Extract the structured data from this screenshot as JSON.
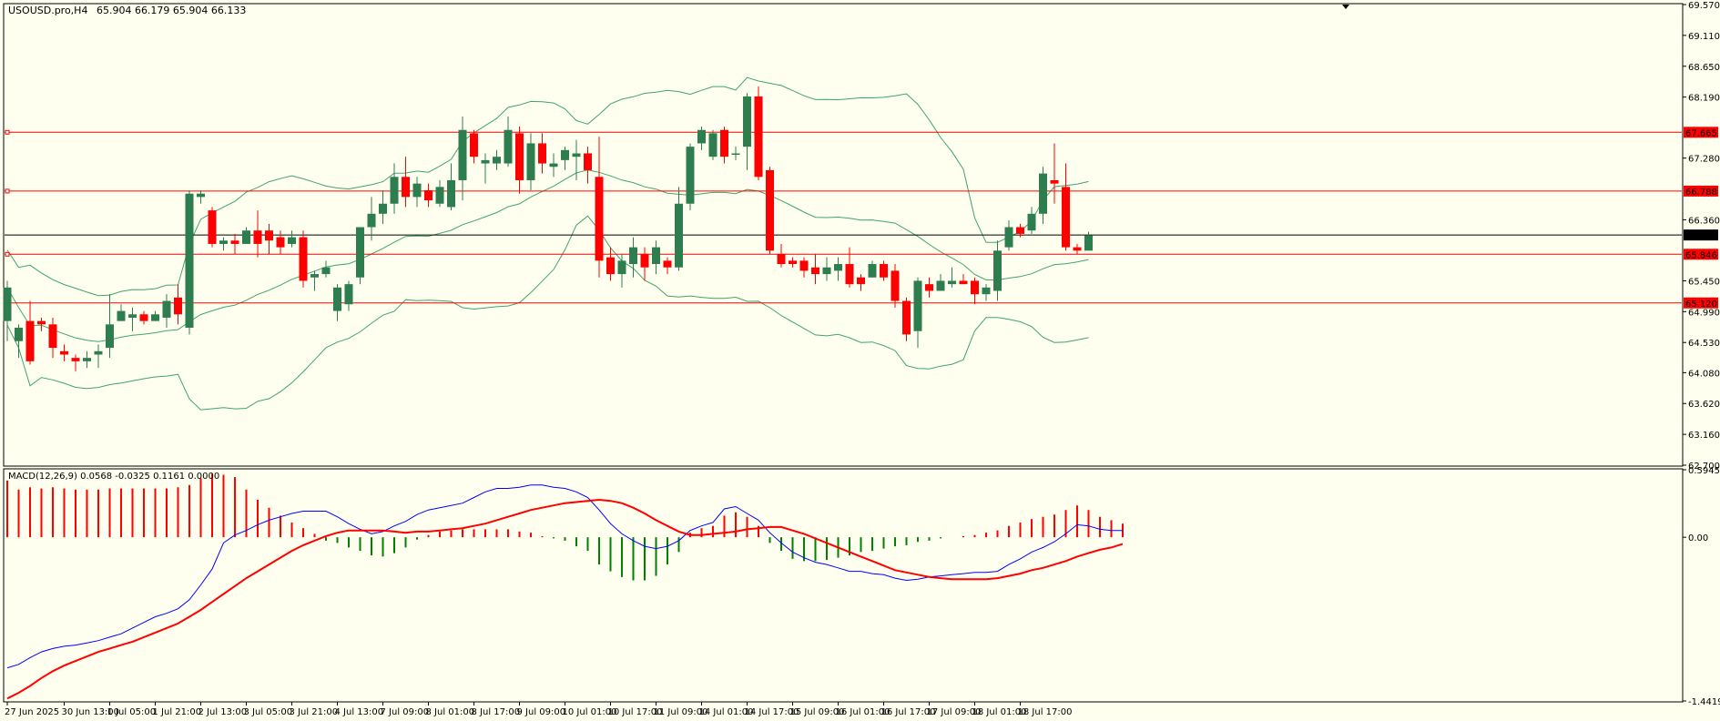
{
  "header": {
    "symbol": "USOUSD.pro,H4",
    "ohlc": "65.904 66.179 65.904 66.133"
  },
  "macd_header": {
    "label": "MACD(12,26,9) 0.0568 -0.0325 0.1161 0.0000"
  },
  "colors": {
    "background": "#FFFFF0",
    "bull_candle": "#2E7D4F",
    "bear_candle": "#FF0000",
    "bollinger": "#3FA56B",
    "hline": "#FF0000",
    "current_price": "#000000",
    "macd_line": "#0000FF",
    "signal_line": "#FF0000"
  },
  "chart_data": [
    {
      "type": "candlestick",
      "title": "USOUSD.pro,H4",
      "ylim": [
        62.7,
        69.57
      ],
      "y_ticks": [
        "69.570",
        "69.110",
        "68.650",
        "68.190",
        "67.280",
        "66.360",
        "65.450",
        "64.990",
        "64.530",
        "64.080",
        "63.620",
        "63.160",
        "62.700"
      ],
      "x_ticks": [
        "27 Jun 2025",
        "30 Jun 13:00",
        "1 Jul 05:00",
        "1 Jul 21:00",
        "2 Jul 13:00",
        "3 Jul 05:00",
        "3 Jul 21:00",
        "4 Jul 13:00",
        "7 Jul 09:00",
        "8 Jul 01:00",
        "8 Jul 17:00",
        "9 Jul 09:00",
        "10 Jul 01:00",
        "10 Jul 17:00",
        "11 Jul 09:00",
        "14 Jul 01:00",
        "14 Jul 17:00",
        "15 Jul 09:00",
        "16 Jul 01:00",
        "16 Jul 17:00",
        "17 Jul 09:00",
        "18 Jul 01:00",
        "18 Jul 17:00"
      ],
      "horizontal_lines": [
        {
          "price": 67.665,
          "label": "67.665"
        },
        {
          "price": 66.788,
          "label": "66.788"
        },
        {
          "price": 65.846,
          "label": "65.846"
        },
        {
          "price": 65.12,
          "label": "65.120"
        }
      ],
      "current_price": {
        "price": 66.133,
        "label": "66.133"
      },
      "candles": [
        [
          64.85,
          65.35,
          64.55,
          65.45
        ],
        [
          64.55,
          64.75,
          64.3,
          64.8
        ],
        [
          64.85,
          64.25,
          64.2,
          65.15
        ],
        [
          64.85,
          64.8,
          64.7,
          64.9
        ],
        [
          64.8,
          64.45,
          64.3,
          64.9
        ],
        [
          64.4,
          64.35,
          64.25,
          64.5
        ],
        [
          64.3,
          64.25,
          64.1,
          64.35
        ],
        [
          64.25,
          64.3,
          64.15,
          64.4
        ],
        [
          64.35,
          64.4,
          64.15,
          64.5
        ],
        [
          64.45,
          64.8,
          64.3,
          65.25
        ],
        [
          64.85,
          65.0,
          64.85,
          65.1
        ],
        [
          64.9,
          64.95,
          64.7,
          65.05
        ],
        [
          64.95,
          64.85,
          64.8,
          65.0
        ],
        [
          64.85,
          64.95,
          64.85,
          65.0
        ],
        [
          64.9,
          65.15,
          64.75,
          65.25
        ],
        [
          65.2,
          64.95,
          64.8,
          65.4
        ],
        [
          64.75,
          66.75,
          64.65,
          66.8
        ],
        [
          66.7,
          66.75,
          66.6,
          66.8
        ],
        [
          66.5,
          66.0,
          65.95,
          66.55
        ],
        [
          66.0,
          66.05,
          65.9,
          66.1
        ],
        [
          66.05,
          66.0,
          65.85,
          66.15
        ],
        [
          66.0,
          66.2,
          66.0,
          66.25
        ],
        [
          66.2,
          66.0,
          65.8,
          66.5
        ],
        [
          66.2,
          66.05,
          65.85,
          66.3
        ],
        [
          66.1,
          65.95,
          65.85,
          66.2
        ],
        [
          66.0,
          66.1,
          65.95,
          66.2
        ],
        [
          66.1,
          65.45,
          65.35,
          66.2
        ],
        [
          65.5,
          65.55,
          65.3,
          65.6
        ],
        [
          65.55,
          65.65,
          65.5,
          65.75
        ],
        [
          65.0,
          65.35,
          64.85,
          65.4
        ],
        [
          65.1,
          65.4,
          65.0,
          65.45
        ],
        [
          65.5,
          66.25,
          65.4,
          66.25
        ],
        [
          66.25,
          66.45,
          66.05,
          66.7
        ],
        [
          66.45,
          66.6,
          66.3,
          66.8
        ],
        [
          66.6,
          67.0,
          66.45,
          67.2
        ],
        [
          67.0,
          66.7,
          66.55,
          67.3
        ],
        [
          66.7,
          66.9,
          66.55,
          67.0
        ],
        [
          66.8,
          66.65,
          66.55,
          66.9
        ],
        [
          66.6,
          66.85,
          66.55,
          66.95
        ],
        [
          66.55,
          66.95,
          66.5,
          67.2
        ],
        [
          66.95,
          67.7,
          66.65,
          67.9
        ],
        [
          67.65,
          67.3,
          67.2,
          67.7
        ],
        [
          67.2,
          67.25,
          66.9,
          67.35
        ],
        [
          67.2,
          67.3,
          67.1,
          67.4
        ],
        [
          67.2,
          67.7,
          67.15,
          67.9
        ],
        [
          67.65,
          66.95,
          66.75,
          67.75
        ],
        [
          66.95,
          67.5,
          66.8,
          67.65
        ],
        [
          67.5,
          67.2,
          67.05,
          67.65
        ],
        [
          67.15,
          67.2,
          67.0,
          67.35
        ],
        [
          67.25,
          67.4,
          67.1,
          67.45
        ],
        [
          67.3,
          67.35,
          66.95,
          67.55
        ],
        [
          67.35,
          67.1,
          66.9,
          67.45
        ],
        [
          67.0,
          65.75,
          65.5,
          67.6
        ],
        [
          65.8,
          65.55,
          65.45,
          65.95
        ],
        [
          65.55,
          65.75,
          65.35,
          65.85
        ],
        [
          65.7,
          65.95,
          65.5,
          66.1
        ],
        [
          65.85,
          65.65,
          65.45,
          65.95
        ],
        [
          65.7,
          65.95,
          65.55,
          66.05
        ],
        [
          65.75,
          65.65,
          65.55,
          65.8
        ],
        [
          65.65,
          66.6,
          65.6,
          66.85
        ],
        [
          66.6,
          67.45,
          66.5,
          67.5
        ],
        [
          67.5,
          67.7,
          67.4,
          67.75
        ],
        [
          67.3,
          67.65,
          67.25,
          67.7
        ],
        [
          67.7,
          67.3,
          67.2,
          67.75
        ],
        [
          67.35,
          67.35,
          67.25,
          67.45
        ],
        [
          67.45,
          68.2,
          67.1,
          68.25
        ],
        [
          68.2,
          67.0,
          66.95,
          68.35
        ],
        [
          67.1,
          65.9,
          65.85,
          67.15
        ],
        [
          65.85,
          65.7,
          65.65,
          66.0
        ],
        [
          65.75,
          65.7,
          65.65,
          65.8
        ],
        [
          65.75,
          65.6,
          65.5,
          65.8
        ],
        [
          65.65,
          65.55,
          65.4,
          65.85
        ],
        [
          65.55,
          65.65,
          65.45,
          65.8
        ],
        [
          65.6,
          65.7,
          65.45,
          65.8
        ],
        [
          65.7,
          65.4,
          65.35,
          65.95
        ],
        [
          65.5,
          65.4,
          65.3,
          65.55
        ],
        [
          65.5,
          65.7,
          65.5,
          65.75
        ],
        [
          65.7,
          65.5,
          65.45,
          65.75
        ],
        [
          65.6,
          65.15,
          65.05,
          65.7
        ],
        [
          65.15,
          64.65,
          64.55,
          65.2
        ],
        [
          64.7,
          65.45,
          64.45,
          65.5
        ],
        [
          65.4,
          65.3,
          65.2,
          65.5
        ],
        [
          65.3,
          65.45,
          65.3,
          65.55
        ],
        [
          65.4,
          65.45,
          65.35,
          65.65
        ],
        [
          65.45,
          65.4,
          65.4,
          65.55
        ],
        [
          65.45,
          65.25,
          65.1,
          65.5
        ],
        [
          65.25,
          65.35,
          65.15,
          65.4
        ],
        [
          65.3,
          65.9,
          65.15,
          66.05
        ],
        [
          65.95,
          66.25,
          65.9,
          66.35
        ],
        [
          66.25,
          66.15,
          66.1,
          66.3
        ],
        [
          66.2,
          66.45,
          66.15,
          66.55
        ],
        [
          66.45,
          67.05,
          66.3,
          67.15
        ],
        [
          66.95,
          66.9,
          66.6,
          67.5
        ],
        [
          66.85,
          65.95,
          65.9,
          67.2
        ],
        [
          65.95,
          65.9,
          65.85,
          66.0
        ],
        [
          65.9,
          66.13,
          65.9,
          66.18
        ]
      ]
    },
    {
      "type": "line",
      "title": "MACD(12,26,9)",
      "ylim": [
        -1.4419,
        0.5945
      ],
      "y_ticks": [
        "0.5945",
        "0.00",
        "-1.4419"
      ],
      "series": [
        {
          "name": "MACD",
          "values": [
            -1.15,
            -1.12,
            -1.06,
            -1.01,
            -0.98,
            -0.96,
            -0.95,
            -0.93,
            -0.91,
            -0.88,
            -0.85,
            -0.8,
            -0.75,
            -0.7,
            -0.67,
            -0.63,
            -0.55,
            -0.42,
            -0.28,
            -0.05,
            0.02,
            0.06,
            0.11,
            0.15,
            0.18,
            0.21,
            0.23,
            0.23,
            0.23,
            0.18,
            0.12,
            0.07,
            0.03,
            0.05,
            0.1,
            0.14,
            0.2,
            0.24,
            0.26,
            0.28,
            0.3,
            0.35,
            0.4,
            0.43,
            0.43,
            0.44,
            0.46,
            0.46,
            0.44,
            0.43,
            0.4,
            0.35,
            0.24,
            0.12,
            0.03,
            -0.03,
            -0.08,
            -0.1,
            -0.08,
            -0.03,
            0.06,
            0.1,
            0.13,
            0.25,
            0.27,
            0.21,
            0.15,
            0.04,
            -0.05,
            -0.13,
            -0.18,
            -0.22,
            -0.24,
            -0.27,
            -0.3,
            -0.3,
            -0.32,
            -0.33,
            -0.36,
            -0.38,
            -0.37,
            -0.35,
            -0.34,
            -0.33,
            -0.32,
            -0.31,
            -0.31,
            -0.3,
            -0.24,
            -0.19,
            -0.13,
            -0.09,
            -0.04,
            0.03,
            0.11,
            0.1,
            0.07,
            0.06,
            0.06
          ]
        },
        {
          "name": "Signal",
          "values": [
            -1.42,
            -1.37,
            -1.31,
            -1.24,
            -1.18,
            -1.13,
            -1.09,
            -1.05,
            -1.01,
            -0.98,
            -0.95,
            -0.92,
            -0.88,
            -0.84,
            -0.8,
            -0.76,
            -0.7,
            -0.64,
            -0.57,
            -0.5,
            -0.43,
            -0.36,
            -0.3,
            -0.24,
            -0.18,
            -0.12,
            -0.07,
            -0.03,
            0.01,
            0.04,
            0.06,
            0.06,
            0.06,
            0.06,
            0.05,
            0.04,
            0.05,
            0.05,
            0.06,
            0.07,
            0.08,
            0.1,
            0.12,
            0.15,
            0.18,
            0.21,
            0.24,
            0.26,
            0.28,
            0.3,
            0.31,
            0.32,
            0.33,
            0.32,
            0.3,
            0.26,
            0.21,
            0.15,
            0.1,
            0.05,
            0.02,
            0.02,
            0.03,
            0.04,
            0.05,
            0.07,
            0.08,
            0.09,
            0.09,
            0.06,
            0.03,
            -0.01,
            -0.05,
            -0.09,
            -0.13,
            -0.17,
            -0.21,
            -0.25,
            -0.29,
            -0.31,
            -0.33,
            -0.35,
            -0.36,
            -0.37,
            -0.37,
            -0.37,
            -0.37,
            -0.36,
            -0.34,
            -0.32,
            -0.29,
            -0.27,
            -0.24,
            -0.21,
            -0.17,
            -0.14,
            -0.11,
            -0.09,
            -0.06
          ]
        },
        {
          "name": "Histogram",
          "values": [
            0.5,
            0.42,
            0.44,
            0.43,
            0.44,
            0.43,
            0.42,
            0.42,
            0.42,
            0.43,
            0.43,
            0.43,
            0.43,
            0.43,
            0.43,
            0.44,
            0.46,
            0.52,
            0.56,
            0.55,
            0.53,
            0.42,
            0.33,
            0.26,
            0.19,
            0.13,
            0.08,
            0.03,
            -0.03,
            -0.05,
            -0.09,
            -0.12,
            -0.16,
            -0.17,
            -0.14,
            -0.09,
            -0.02,
            0.02,
            0.05,
            0.06,
            0.07,
            0.07,
            0.07,
            0.07,
            0.07,
            0.05,
            0.04,
            0.01,
            -0.01,
            -0.03,
            -0.08,
            -0.12,
            -0.24,
            -0.3,
            -0.35,
            -0.38,
            -0.38,
            -0.34,
            -0.24,
            -0.13,
            0.04,
            0.08,
            0.1,
            0.19,
            0.22,
            0.18,
            0.1,
            -0.05,
            -0.12,
            -0.19,
            -0.21,
            -0.21,
            -0.2,
            -0.18,
            -0.16,
            -0.13,
            -0.12,
            -0.1,
            -0.08,
            -0.07,
            -0.04,
            -0.03,
            -0.01,
            0.0,
            0.01,
            0.02,
            0.04,
            0.06,
            0.1,
            0.13,
            0.16,
            0.18,
            0.2,
            0.24,
            0.28,
            0.24,
            0.18,
            0.15,
            0.12
          ]
        }
      ]
    }
  ]
}
